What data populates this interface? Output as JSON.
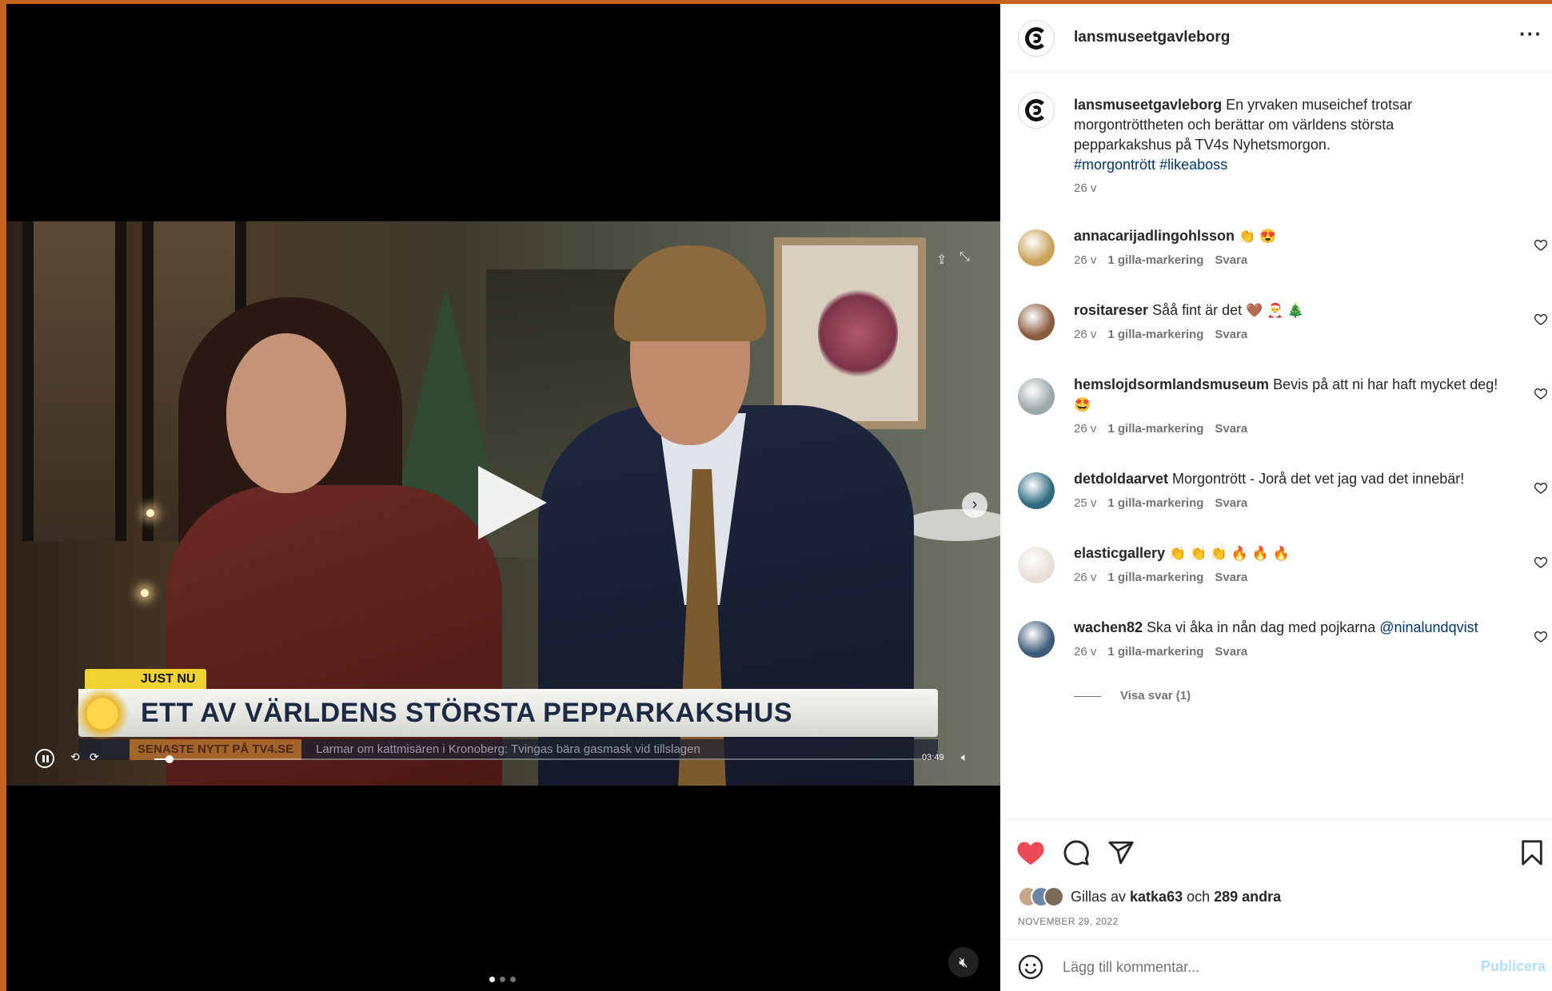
{
  "post": {
    "username": "lansmuseetgavleborg",
    "more_icon": "more-horizontal-icon",
    "caption": {
      "username": "lansmuseetgavleborg",
      "text": " En yrvaken museichef trotsar morgontröttheten och berättar om världens största pepparkakshus på TV4s Nyhetsmorgon.",
      "hashtags": [
        "#morgontrött",
        "#likeaboss"
      ],
      "age": "26 v"
    }
  },
  "video": {
    "badge": "JUST NU",
    "headline": "ETT AV VÄRLDENS STÖRSTA PEPPARKAKSHUS",
    "ticker_tag": "SENASTE NYTT PÅ TV4.SE",
    "ticker_text": "Larmar om kattmisären i Kronoberg: Tvingas bära gasmask vid tillslagen",
    "time": "03:49",
    "progress": 0.02,
    "carousel": {
      "count": 3,
      "active": 0
    }
  },
  "comments": [
    {
      "user": "annacarijadlingohlsson",
      "text": "",
      "emoji": "👏 😍",
      "age": "26 v",
      "likes": "1 gilla-markering",
      "reply": "Svara",
      "avatar_color": "#c9a25a"
    },
    {
      "user": "rositareser",
      "text": " Såå fint är det",
      "emoji": "🤎 🎅 🎄",
      "age": "26 v",
      "likes": "1 gilla-markering",
      "reply": "Svara",
      "avatar_color": "#8a5a3c"
    },
    {
      "user": "hemslojdsormlandsmuseum",
      "text": " Bevis på att ni har haft mycket deg!",
      "emoji": "🤩",
      "age": "26 v",
      "likes": "1 gilla-markering",
      "reply": "Svara",
      "avatar_color": "#9aa7a8"
    },
    {
      "user": "detdoldaarvet",
      "text": " Morgontrött - Jorå det vet jag vad det innebär!",
      "emoji": "",
      "age": "25 v",
      "likes": "1 gilla-markering",
      "reply": "Svara",
      "avatar_color": "#2f6b80"
    },
    {
      "user": "elasticgallery",
      "text": "",
      "emoji": "👏 👏 👏 🔥 🔥 🔥",
      "age": "26 v",
      "likes": "1 gilla-markering",
      "reply": "Svara",
      "avatar_color": "#e6e0d6"
    },
    {
      "user": "wachen82",
      "text": " Ska vi åka in nån dag med pojkarna ",
      "mention": "@ninalundqvist",
      "emoji": "",
      "age": "26 v",
      "likes": "1 gilla-markering",
      "reply": "Svara",
      "avatar_color": "#3d5a7a"
    }
  ],
  "view_replies": "Visa svar (1)",
  "likes": {
    "prefix": "Gillas av ",
    "user": "katka63",
    "middle": " och ",
    "others": "289 andra"
  },
  "date": "NOVEMBER 29, 2022",
  "add_comment": {
    "placeholder": "Lägg till kommentar...",
    "post_label": "Publicera"
  },
  "colors": {
    "like_red": "#ed4956",
    "link_blue": "#00376b",
    "post_disabled": "#b2dffc"
  }
}
